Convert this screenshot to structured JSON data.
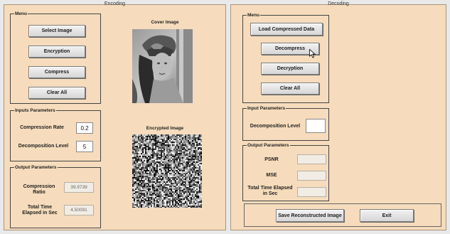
{
  "encoding": {
    "panel_title": "Encoding",
    "menu": {
      "title": "Menu",
      "select_image": "Select Image",
      "encryption": "Encryption",
      "compress": "Compress",
      "clear_all": "Clear All"
    },
    "inputs": {
      "title": "Inputs Parameters",
      "compression_rate_label": "Compression Rate",
      "compression_rate_value": "0.2",
      "decomposition_level_label": "Decomposition Level",
      "decomposition_level_value": "5"
    },
    "outputs": {
      "title": "Output Parameters",
      "compression_ratio_label": "Compression Ratio",
      "compression_ratio_value": "39.9739",
      "total_time_label": "Total Time Elapsed in Sec",
      "total_time_value": "4.50091"
    },
    "cover_image_label": "Cover Image",
    "encrypted_image_label": "Encrypted Image"
  },
  "decoding": {
    "panel_title": "Decoding",
    "menu": {
      "title": "Menu",
      "load_compressed": "Load Compressed Data",
      "decompress": "Decompress",
      "decryption": "Decryption",
      "clear_all": "Clear All"
    },
    "inputs": {
      "title": "Input Parameters",
      "decomposition_level_label": "Decomposition Level",
      "decomposition_level_value": ""
    },
    "outputs": {
      "title": "Output Parameters",
      "psnr_label": "PSNR",
      "psnr_value": "",
      "mse_label": "MSE",
      "mse_value": "",
      "total_time_label": "Total Time Elapsed in Sec",
      "total_time_value": ""
    },
    "save_button": "Save Reconstructed Image",
    "exit_button": "Exit"
  },
  "icons": {
    "cursor": "mouse-pointer-icon"
  },
  "colors": {
    "panel_bg": "#f6dcbc",
    "button_bg": "#e4e4e4",
    "group_border": "#444444"
  }
}
